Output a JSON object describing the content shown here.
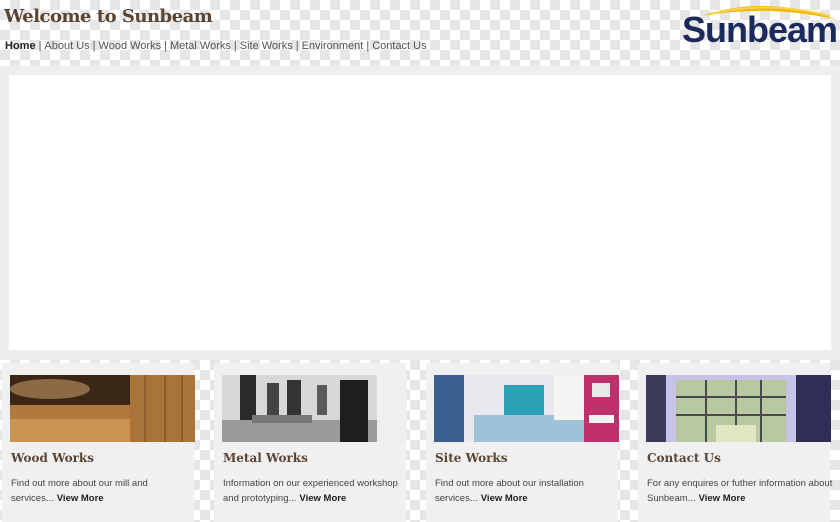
{
  "header": {
    "title": "Welcome to Sunbeam",
    "logo_text": "Sunbeam"
  },
  "nav": {
    "items": [
      "Home",
      "About Us",
      "Wood Works",
      "Metal Works",
      "Site Works",
      "Environment",
      "Contact Us"
    ],
    "separator": "|"
  },
  "cards": [
    {
      "title": "Wood Works",
      "text": "Find out more about our mill and services...",
      "link": "View More",
      "image": "wood-interior-photo"
    },
    {
      "title": "Metal Works",
      "text": "Information on our experienced workshop and prototyping...",
      "link": "View More",
      "image": "retail-store-photo"
    },
    {
      "title": "Site Works",
      "text": "Find out more about our installation services...",
      "link": "View More",
      "image": "bathroom-photo"
    },
    {
      "title": "Contact Us",
      "text": "For any enquires or futher information about Sunbeam...",
      "link": "View More",
      "image": "building-facade-photo"
    }
  ],
  "colors": {
    "title": "#5a4535",
    "logo": "#1b2a5c",
    "swoosh": "#f2b705",
    "panel": "#eeeeee"
  }
}
